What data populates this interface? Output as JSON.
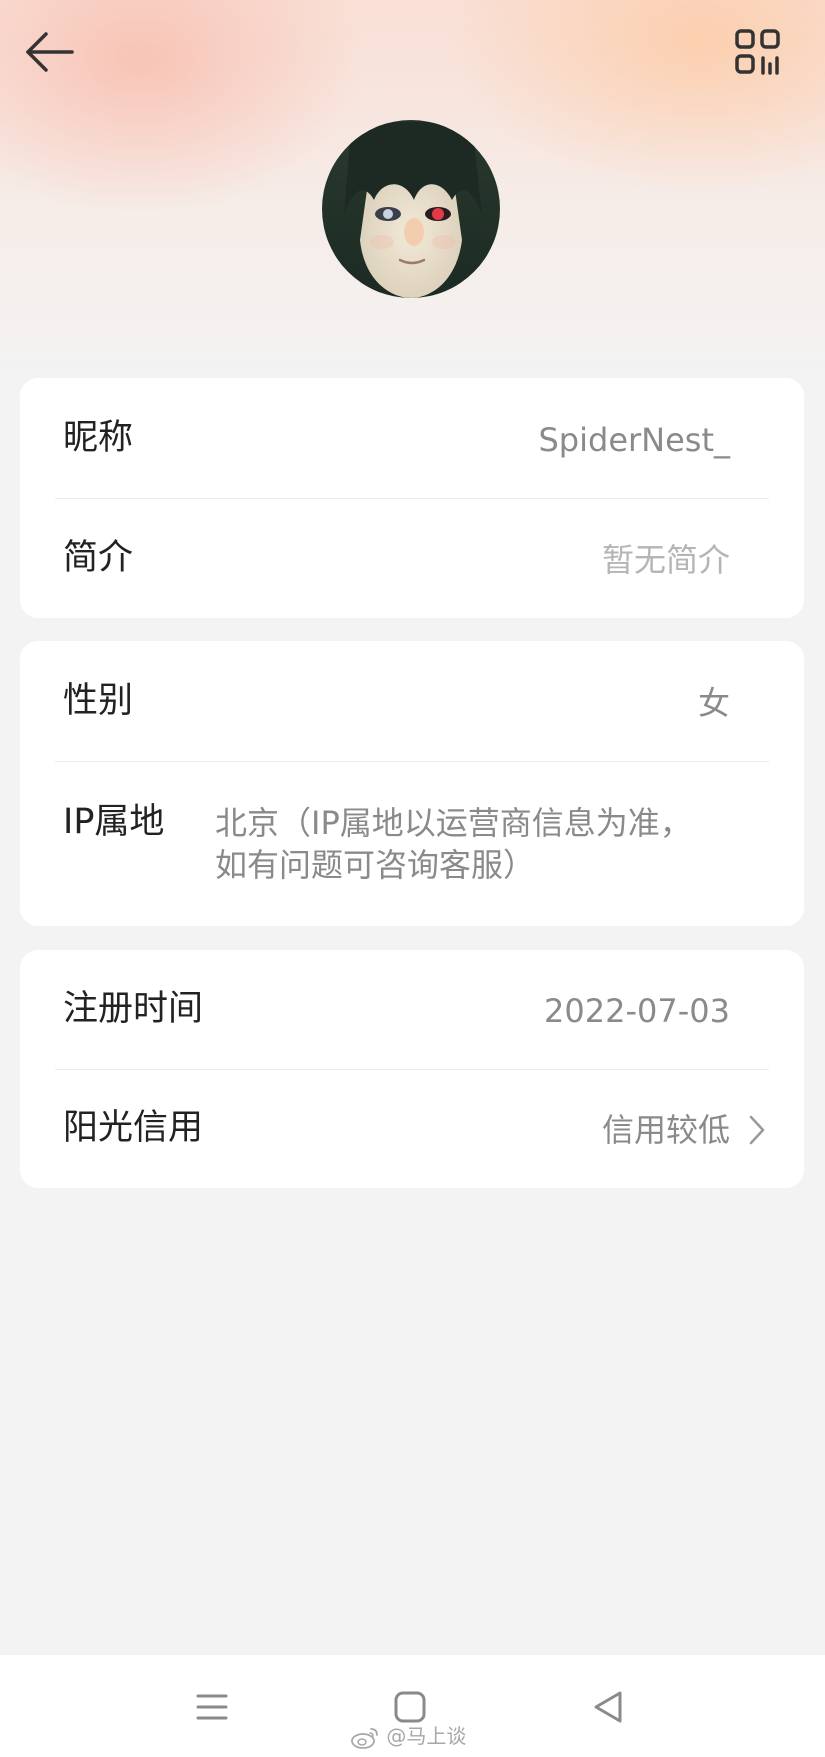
{
  "header": {
    "back_icon": "arrow-left-icon",
    "qr_icon": "qr-code-icon",
    "avatar_alt": "头像"
  },
  "profile_card": {
    "nickname_label": "昵称",
    "nickname_value": "SpiderNest_",
    "bio_label": "简介",
    "bio_value": "暂无简介"
  },
  "info_card": {
    "gender_label": "性别",
    "gender_value": "女",
    "ip_label": "IP属地",
    "ip_value_line1": "北京（IP属地以运营商信息为准，",
    "ip_value_line2": "如有问题可咨询客服）"
  },
  "account_card": {
    "register_label": "注册时间",
    "register_value": "2022-07-03",
    "credit_label": "阳光信用",
    "credit_value": "信用较低"
  },
  "system_nav": {
    "menu_icon": "menu-icon",
    "home_icon": "home-square-icon",
    "back_icon": "back-triangle-icon"
  },
  "watermark": {
    "text": "@马上谈",
    "icon": "weibo-icon"
  },
  "colors": {
    "label": "#222222",
    "value": "#8a8a8a",
    "placeholder": "#b5b5b5",
    "card": "#ffffff",
    "background": "#f3f3f3"
  }
}
